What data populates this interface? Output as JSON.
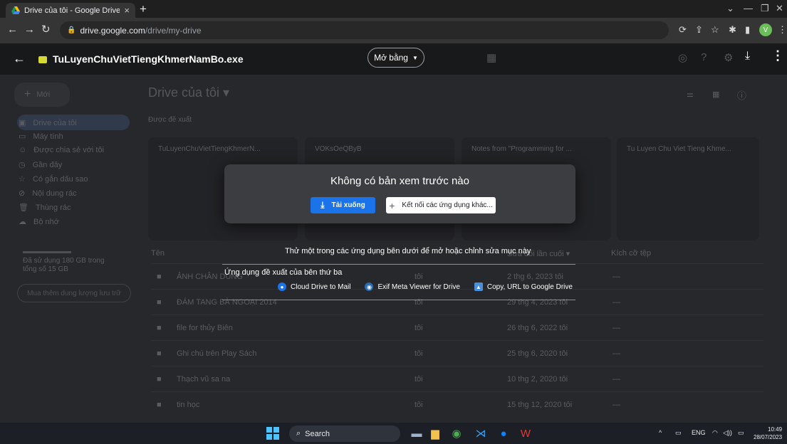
{
  "browser": {
    "tab_title": "Drive của tôi - Google Drive",
    "tab_close": "×",
    "new_tab": "+",
    "url_host": "drive.google.com",
    "url_path": "/drive/my-drive"
  },
  "viewer": {
    "file_name": "TuLuyenChuVietTiengKhmerNamBo.exe",
    "open_with": "Mở bằng",
    "dialog_title": "Không có bản xem trước nào",
    "download_label": "Tải xuống",
    "connect_label": "Kết nối các ứng dụng khác...",
    "try_text": "Thử một trong các ứng dụng bên dưới để mở hoặc chỉnh sửa mục này",
    "suggest_label": "Ứng dụng đề xuất của bên thứ ba",
    "apps": [
      {
        "name": "Cloud Drive to Mail",
        "color": "#1a73e8"
      },
      {
        "name": "Exif Meta Viewer for Drive",
        "color": "#2b6cb0"
      },
      {
        "name": "Copy, URL to Google Drive",
        "color": "#4a90d9"
      }
    ]
  },
  "drive": {
    "new_label": "Mới",
    "page_title": "Drive của tôi ▾",
    "suggested_label": "Được đề xuất",
    "nav": [
      "Drive của tôi",
      "Máy tính",
      "Được chia sẻ với tôi",
      "Gần đây",
      "Có gắn dấu sao",
      "Nội dung rác",
      "Thùng rác",
      "Bộ nhớ"
    ],
    "storage_text_1": "Đã sử dụng 180 GB trong",
    "storage_text_2": "tổng số 15 GB",
    "buy_storage": "Mua thêm dung lượng lưu trữ",
    "cards": [
      "TuLuyenChuVietTiengKhmerN...",
      "VOKsOeQByB",
      "Notes from \"Programming for ...",
      "Tu Luyen Chu Viet Tieng Khme..."
    ],
    "col_name": "Tên",
    "col_modified": "Sửa đổi lần cuối ▾",
    "col_size": "Kích cỡ tệp",
    "rows": [
      {
        "name": "ẢNH CHÂN DUNG",
        "owner": "tôi",
        "date": "2 thg 6, 2023 tôi",
        "size": "—"
      },
      {
        "name": "ĐÁM TANG BÀ NGOẠI 2014",
        "owner": "tôi",
        "date": "29 thg 4, 2023 tôi",
        "size": "—"
      },
      {
        "name": "file for thủy Biên",
        "owner": "tôi",
        "date": "26 thg 6, 2022 tôi",
        "size": "—"
      },
      {
        "name": "Ghi chú trên Play Sách",
        "owner": "tôi",
        "date": "25 thg 6, 2020 tôi",
        "size": "—"
      },
      {
        "name": "Thạch vũ sa na",
        "owner": "tôi",
        "date": "10 thg 2, 2020 tôi",
        "size": "—"
      },
      {
        "name": "tin học",
        "owner": "tôi",
        "date": "15 thg 12, 2020 tôi",
        "size": "—"
      }
    ]
  },
  "taskbar": {
    "search_label": "Search",
    "lang": "ENG",
    "time": "10:49",
    "date": "28/07/2023"
  },
  "colors": {
    "accent": "#1a73e8",
    "dialog_bg": "#3c3d41",
    "page_bg": "#27282b"
  }
}
